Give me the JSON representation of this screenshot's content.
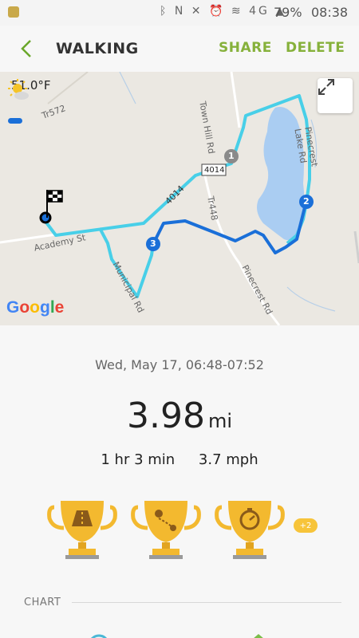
{
  "status_bar": {
    "battery": "79%",
    "time": "08:38",
    "network": "4G"
  },
  "header": {
    "title": "WALKING",
    "share_label": "SHARE",
    "delete_label": "DELETE"
  },
  "map": {
    "temperature": "51.0°F",
    "roads": [
      "Tr572",
      "Town Hill Rd",
      "4014",
      "4014",
      "Tr448",
      "Academy St",
      "Municipal Rd",
      "Pinecrest Rd",
      "Pinecrest Lake Rd"
    ],
    "markers": [
      "1",
      "2",
      "3"
    ],
    "attribution": "Google"
  },
  "summary": {
    "date_range": "Wed, May 17, 06:48-07:52",
    "distance_value": "3.98",
    "distance_unit": "mi",
    "duration": "1 hr 3 min",
    "speed": "3.7 mph"
  },
  "trophies": {
    "items": [
      "road-trophy",
      "route-trophy",
      "stopwatch-trophy"
    ],
    "extra": "+2"
  },
  "chart": {
    "label": "CHART"
  },
  "colors": {
    "accent": "#86b13b",
    "route": "#1a6fd8",
    "route_light": "#3ec6e0",
    "water": "#aacdf2",
    "trophy": "#f3b92f"
  }
}
